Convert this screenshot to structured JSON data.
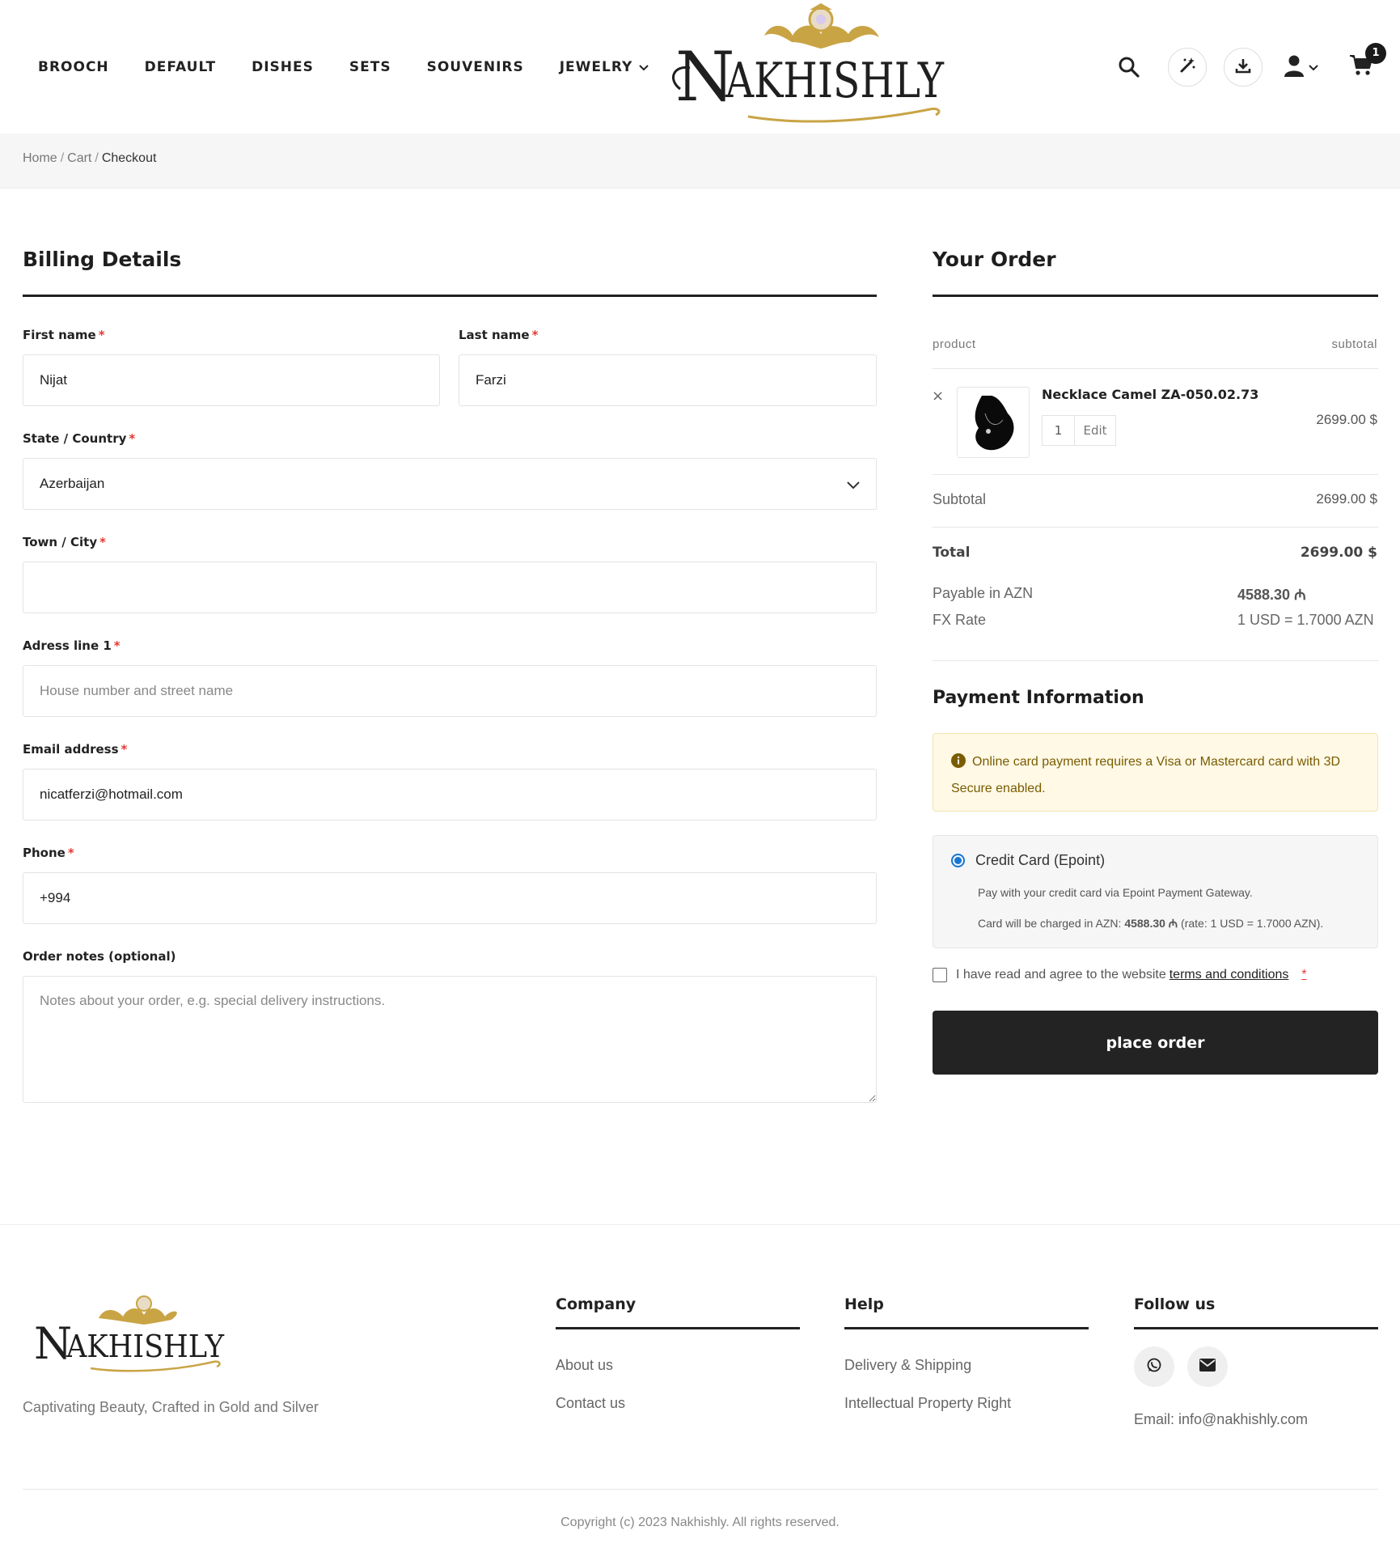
{
  "nav": {
    "items": [
      "BROOCH",
      "DEFAULT",
      "DISHES",
      "SETS",
      "SOUVENIRS",
      "JEWELRY"
    ]
  },
  "brand": {
    "name": "NAKHISHLY",
    "logo_initial": "N",
    "logo_rest": "AKHISHLY",
    "gold": "#c9a445",
    "ink": "#1f1f1f"
  },
  "header_icons": [
    "search-icon",
    "magic-wand-icon",
    "download-icon",
    "user-icon",
    "cart-icon"
  ],
  "cart": {
    "count": "1"
  },
  "breadcrumb": {
    "home": "Home",
    "cart": "Cart",
    "current": "Checkout",
    "sep": "/"
  },
  "billing": {
    "title": "Billing Details",
    "required_mark": "*",
    "first_name": {
      "label": "First name",
      "value": "Nijat"
    },
    "last_name": {
      "label": "Last name",
      "value": "Farzi"
    },
    "country": {
      "label": "State / Country",
      "value": "Azerbaijan"
    },
    "city": {
      "label": "Town / City",
      "value": ""
    },
    "address": {
      "label": "Adress line 1",
      "placeholder": "House number and street name"
    },
    "email": {
      "label": "Email address",
      "value": "nicatferzi@hotmail.com"
    },
    "phone": {
      "label": "Phone",
      "value": "+994"
    },
    "notes": {
      "label": "Order notes (optional)",
      "placeholder": "Notes about your order, e.g. special delivery instructions."
    }
  },
  "order": {
    "title": "Your Order",
    "col_product": "product",
    "col_subtotal": "subtotal",
    "remove": "×",
    "item": {
      "name": "Necklace Camel ZA-050.02.73",
      "qty": "1",
      "edit": "Edit",
      "price": "2699.00 $"
    },
    "subtotal_label": "Subtotal",
    "subtotal_value": "2699.00 $",
    "total_label": "Total",
    "total_value": "2699.00 $",
    "azn_label": "Payable in AZN",
    "azn_value": "4588.30 ₼",
    "fx_label": "FX Rate",
    "fx_value": "1 USD = 1.7000 AZN"
  },
  "payment": {
    "title": "Payment Information",
    "notice": "Online card payment requires a Visa or Mastercard card with 3D Secure enabled.",
    "method_label": "Credit Card (Epoint)",
    "method_desc": "Pay with your credit card via Epoint Payment Gateway.",
    "charge_prefix": "Card will be charged in AZN: ",
    "charge_amount": "4588.30 ₼",
    "charge_suffix": " (rate: 1 USD = 1.7000 AZN).",
    "terms_text": "I have read and agree to the website",
    "terms_link": "terms and conditions",
    "terms_req": "*",
    "place_order": "place order",
    "accent": "#1976d2",
    "notice_color": "#7a5c00"
  },
  "footer": {
    "tagline": "Captivating Beauty, Crafted in Gold and Silver",
    "company": {
      "title": "Company",
      "links": [
        "About us",
        "Contact us"
      ]
    },
    "help": {
      "title": "Help",
      "links": [
        "Delivery & Shipping",
        "Intellectual Property Right"
      ]
    },
    "follow": {
      "title": "Follow us",
      "email": "Email: info@nakhishly.com"
    },
    "social_icons": [
      "whatsapp-icon",
      "mail-icon"
    ],
    "copyright": "Copyright (c) 2023 Nakhishly. All rights reserved."
  }
}
